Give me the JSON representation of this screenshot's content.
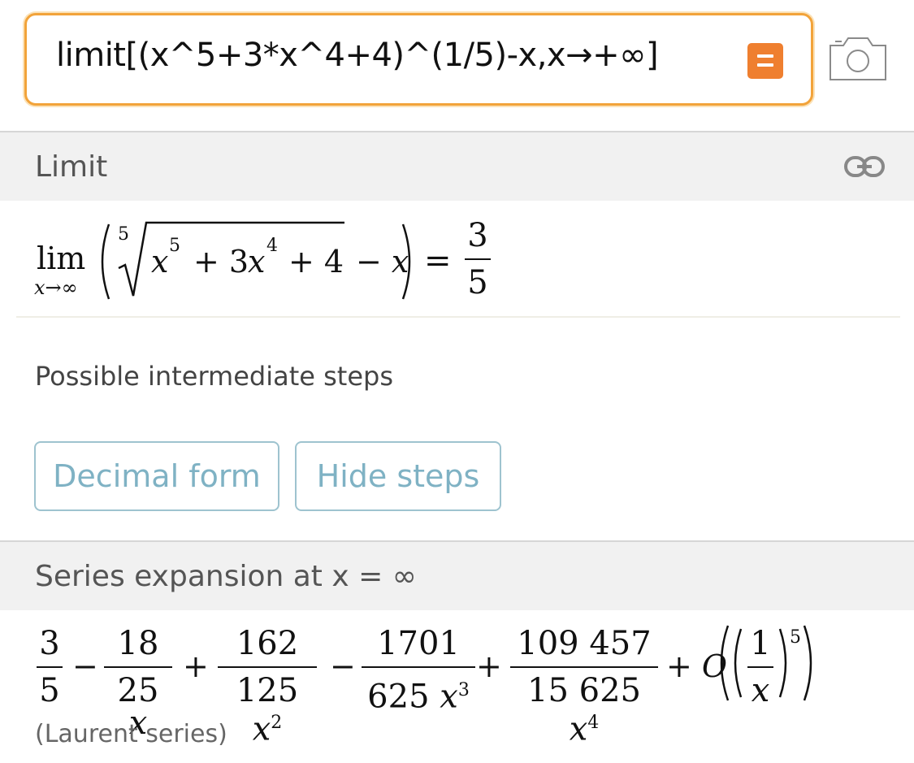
{
  "input": {
    "query": "limit[(x^5+3*x^4+4)^(1/5)-x,x→+∞]"
  },
  "icons": {
    "submit": "equals-icon",
    "camera": "camera-icon",
    "link": "link-icon"
  },
  "colors": {
    "accent": "#ef7f2f",
    "input_border": "#f2a33a",
    "button_text": "#7fb2c4"
  },
  "limit_pod": {
    "title": "Limit",
    "lim": "lim",
    "sub": "x→∞",
    "root_index": "5",
    "radicand": [
      "x",
      "5",
      "+ 3",
      "x",
      "4",
      "+ 4"
    ],
    "minus_x": "− x",
    "equals": "=",
    "result_num": "3",
    "result_den": "5",
    "steps_label": "Possible intermediate steps",
    "buttons": [
      "Decimal form",
      "Hide steps"
    ]
  },
  "series_pod": {
    "title": "Series expansion at x = ∞",
    "terms": [
      {
        "num": "3",
        "den": "5",
        "den_pow": ""
      },
      {
        "op": "−",
        "num": "18",
        "den": "25",
        "den_var": "x",
        "den_pow": ""
      },
      {
        "op": "+",
        "num": "162",
        "den": "125",
        "den_var": "x",
        "den_pow": "2"
      },
      {
        "op": "−",
        "num": "1701",
        "den": "625",
        "den_var": "x",
        "den_pow": "3"
      },
      {
        "op": "+",
        "num": "109 457",
        "den": "15 625",
        "den_var": "x",
        "den_pow": "4"
      }
    ],
    "big_o": "+ O",
    "big_o_num": "1",
    "big_o_den": "x",
    "big_o_pow": "5",
    "note": "(Laurent series)"
  }
}
